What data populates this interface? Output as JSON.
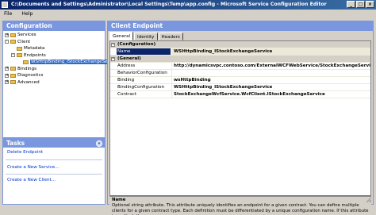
{
  "window": {
    "title": "C:\\Documents and Settings\\Administrator\\Local Settings\\Temp\\app.config - Microsoft Service Configuration Editor",
    "minimize": "_",
    "maximize": "□",
    "close": "×"
  },
  "menu": {
    "file": "File",
    "help": "Help"
  },
  "configuration": {
    "header": "Configuration",
    "tree": [
      {
        "label": "Services",
        "depth": 0,
        "expander": "+"
      },
      {
        "label": "Client",
        "depth": 0,
        "expander": "-"
      },
      {
        "label": "Metadata",
        "depth": 1,
        "expander": ""
      },
      {
        "label": "Endpoints",
        "depth": 1,
        "expander": "-"
      },
      {
        "label": "WSHttpBinding_IStockExchangeSe",
        "depth": 2,
        "expander": "",
        "selected": true
      },
      {
        "label": "Bindings",
        "depth": 0,
        "expander": "+"
      },
      {
        "label": "Diagnostics",
        "depth": 0,
        "expander": "+"
      },
      {
        "label": "Advanced",
        "depth": 0,
        "expander": "+"
      }
    ]
  },
  "tasks": {
    "header": "Tasks",
    "collapse": "«",
    "items": [
      "Delete Endpoint",
      "Create a New Service...",
      "Create a New Client..."
    ]
  },
  "endpoint": {
    "header": "Client Endpoint",
    "tabs": [
      "General",
      "Identity",
      "Headers"
    ],
    "grid": [
      {
        "type": "cat",
        "label": "(Configuration)",
        "mark": "-"
      },
      {
        "type": "prop",
        "name": "Name",
        "value": "WSHttpBinding_IStockExchangeService",
        "selected": true
      },
      {
        "type": "cat",
        "label": "(General)",
        "mark": "-"
      },
      {
        "type": "prop",
        "name": "Address",
        "value": "http://dynamicsvpc.contoso.com/ExternalWCFWebService/StockExchangeService.svc"
      },
      {
        "type": "prop",
        "name": "BehaviorConfiguration",
        "value": ""
      },
      {
        "type": "prop",
        "name": "Binding",
        "value": "wsHttpBinding"
      },
      {
        "type": "prop",
        "name": "BindingConfiguration",
        "value": "WSHttpBinding_IStockExchangeService"
      },
      {
        "type": "prop",
        "name": "Contract",
        "value": "StockExchangeWcfService.WcfClient.IStockExchangeService"
      }
    ],
    "description_title": "Name",
    "description_text": "Optional string attribute. This attribute uniquely identifies an endpoint for a given contract. You can define multiple clients for a given contract type. Each definition must be differentiated by a unique configuration name. If this attribute is omitted, the correspo"
  }
}
